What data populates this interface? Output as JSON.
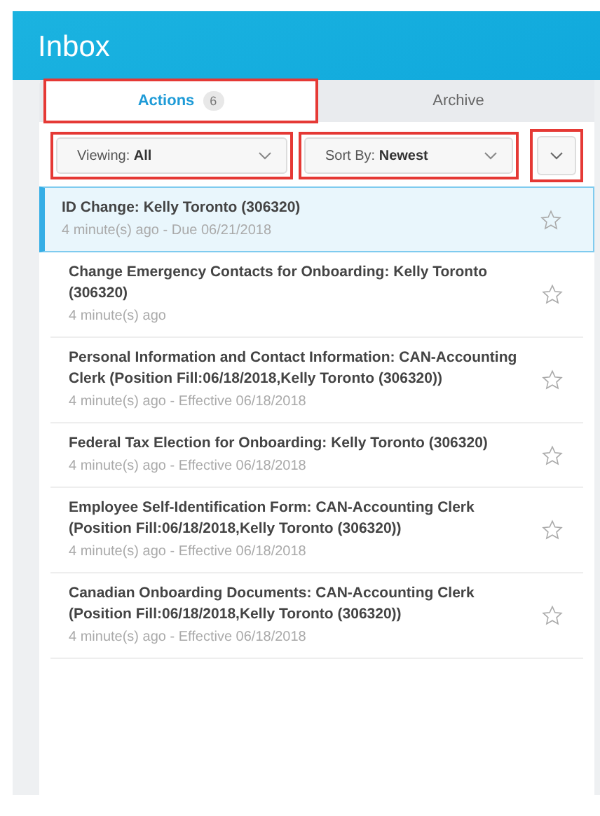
{
  "header": {
    "title": "Inbox"
  },
  "tabs": [
    {
      "label": "Actions",
      "count": "6",
      "selected": true,
      "highlighted": true
    },
    {
      "label": "Archive",
      "selected": false,
      "highlighted": false
    }
  ],
  "filters": [
    {
      "label": "Viewing:",
      "value": "All",
      "highlighted": true
    },
    {
      "label": "Sort By:",
      "value": "Newest",
      "highlighted": true
    }
  ],
  "menu_button": {
    "highlighted": true
  },
  "items": [
    {
      "title": "ID Change: Kelly Toronto (306320)",
      "meta": "4 minute(s) ago - Due 06/21/2018",
      "selected": true,
      "starred": false
    },
    {
      "title": "Change Emergency Contacts for Onboarding: Kelly Toronto (306320)",
      "meta": "4 minute(s) ago",
      "selected": false,
      "starred": false
    },
    {
      "title": "Personal Information and Contact Information: CAN-Accounting Clerk (Position Fill:06/18/2018,Kelly Toronto (306320))",
      "meta": "4 minute(s) ago - Effective 06/18/2018",
      "selected": false,
      "starred": false
    },
    {
      "title": "Federal Tax Election for Onboarding: Kelly Toronto (306320)",
      "meta": "4 minute(s) ago - Effective 06/18/2018",
      "selected": false,
      "starred": false
    },
    {
      "title": "Employee Self-Identification Form: CAN-Accounting Clerk (Position Fill:06/18/2018,Kelly Toronto (306320))",
      "meta": "4 minute(s) ago - Effective 06/18/2018",
      "selected": false,
      "starred": false
    },
    {
      "title": "Canadian Onboarding Documents: CAN-Accounting Clerk (Position Fill:06/18/2018,Kelly Toronto (306320))",
      "meta": "4 minute(s) ago - Effective 06/18/2018",
      "selected": false,
      "starred": false
    }
  ]
}
